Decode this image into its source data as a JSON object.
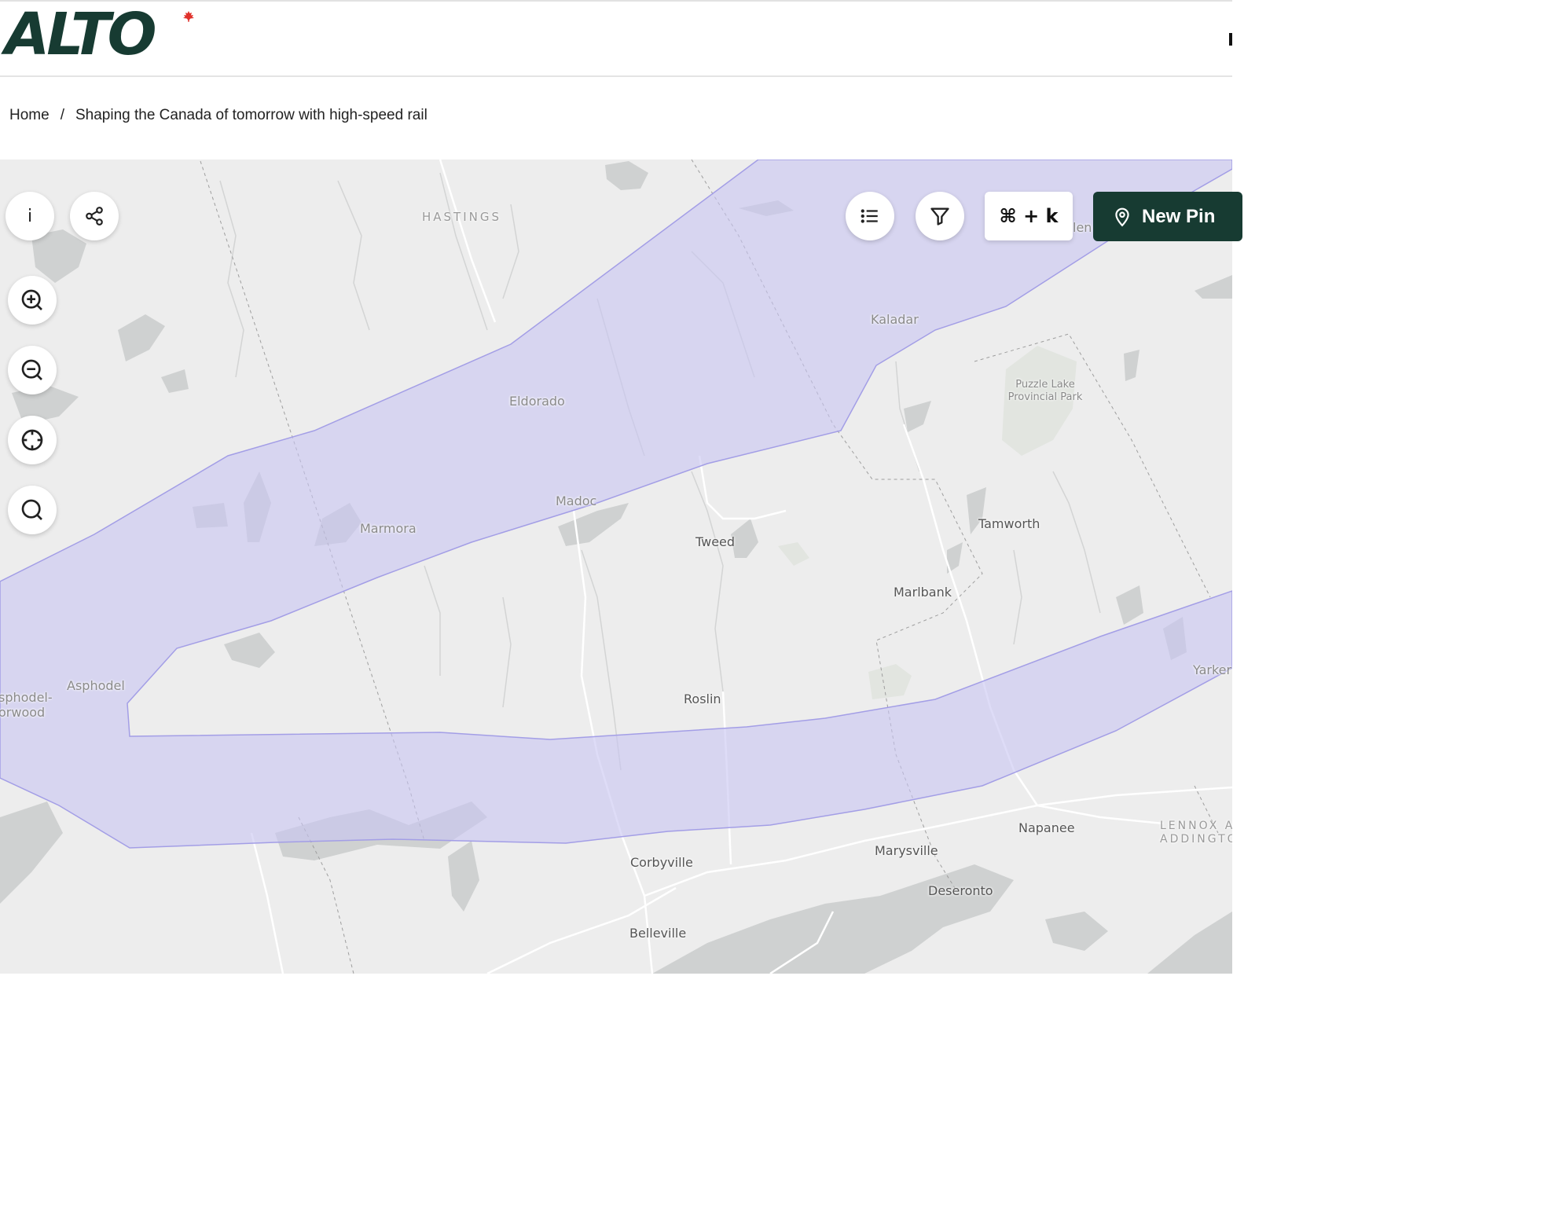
{
  "header": {
    "logo_text": "ALTO",
    "logo_mark": "maple-leaf-icon",
    "brand_color": "#173b32",
    "accent_color": "#e0312b"
  },
  "breadcrumb": {
    "home": "Home",
    "separator": "/",
    "current": "Shaping the Canada of tomorrow with high-speed rail"
  },
  "map": {
    "corridor_color": "#d9d7f6",
    "corridor_stroke": "#a9a4e6",
    "labels": {
      "hastings": "HASTINGS",
      "kaladar": "Kaladar",
      "eldorado": "Eldorado",
      "puzzle_lake": "Puzzle Lake Provincial Park",
      "madoc": "Madoc",
      "marmora": "Marmora",
      "tweed": "Tweed",
      "tamworth": "Tamworth",
      "marlbank": "Marlbank",
      "asphodel": "Asphodel",
      "asphodel_norwood": "sphodel-\norwood",
      "roslin": "Roslin",
      "yarker": "Yarker",
      "napanee": "Napanee",
      "lennox": "LENNOX AI\nADDINGTO",
      "marysville": "Marysville",
      "corbyville": "Corbyville",
      "deseronto": "Deseronto",
      "belleville": "Belleville",
      "len_partial": "len"
    }
  },
  "controls": {
    "info_label": "i",
    "info_icon": "info-icon",
    "share_icon": "share-icon",
    "zoom_in_icon": "zoom-in-icon",
    "zoom_out_icon": "zoom-out-icon",
    "locate_icon": "crosshair-icon",
    "search_icon": "search-icon",
    "list_icon": "list-icon",
    "filter_icon": "filter-icon",
    "shortcut_label": "⌘ + k",
    "new_pin_label": "New Pin",
    "new_pin_icon": "map-pin-icon"
  }
}
